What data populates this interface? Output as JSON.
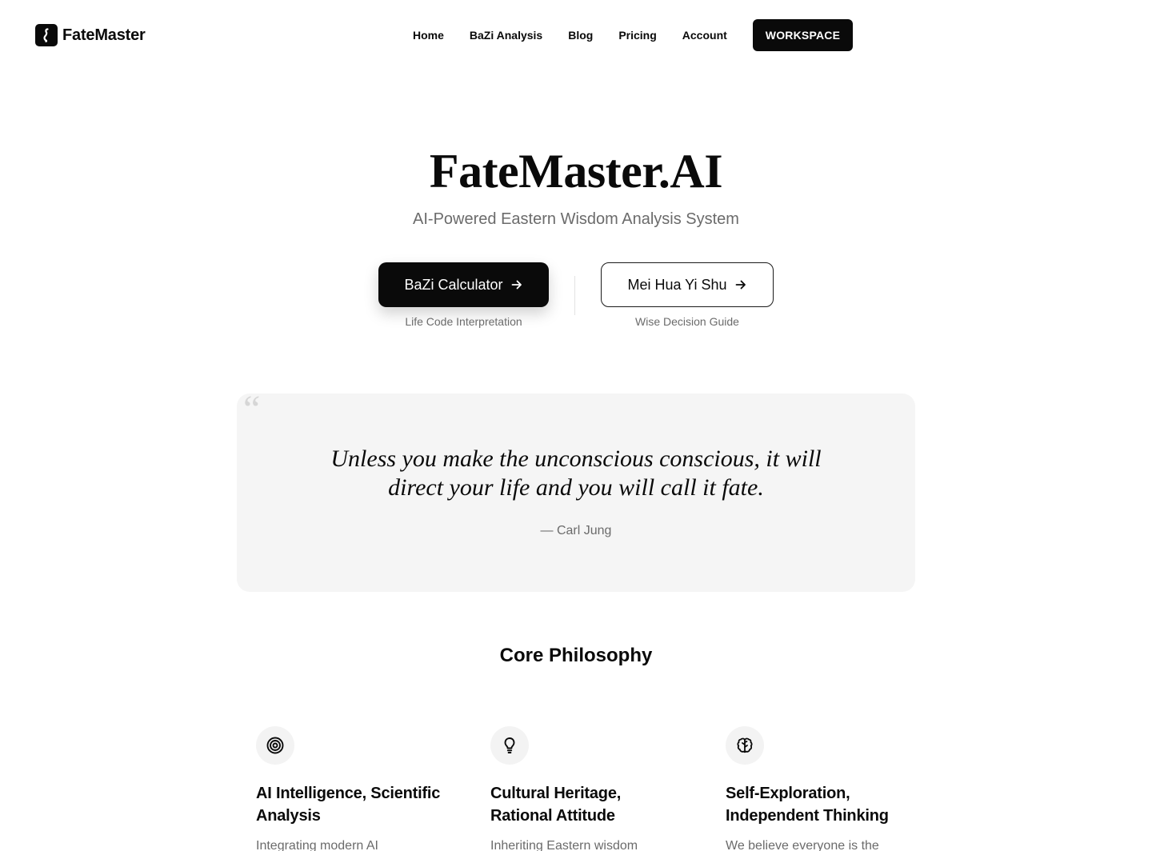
{
  "brand": {
    "name": "FateMaster"
  },
  "nav": {
    "links": [
      "Home",
      "BaZi Analysis",
      "Blog",
      "Pricing",
      "Account"
    ],
    "workspace_label": "WORKSPACE"
  },
  "hero": {
    "title": "FateMaster.AI",
    "subtitle": "AI-Powered Eastern Wisdom Analysis System",
    "primary": {
      "label": "BaZi Calculator",
      "caption": "Life Code Interpretation"
    },
    "secondary": {
      "label": "Mei Hua Yi Shu",
      "caption": "Wise Decision Guide"
    }
  },
  "quote": {
    "mark": "“",
    "text": "Unless you make the unconscious conscious, it will direct your life and you will call it fate.",
    "author": "— Carl Jung"
  },
  "philosophy": {
    "title": "Core Philosophy",
    "items": [
      {
        "icon": "target-icon",
        "title": "AI Intelligence, Scientific Analysis",
        "desc": "Integrating modern AI"
      },
      {
        "icon": "lightbulb-icon",
        "title": "Cultural Heritage, Rational Attitude",
        "desc": "Inheriting Eastern wisdom"
      },
      {
        "icon": "brain-icon",
        "title": "Self-Exploration, Independent Thinking",
        "desc": "We believe everyone is the"
      }
    ]
  },
  "colors": {
    "primary": "#0a0a0a",
    "muted": "#6b6b6b",
    "card": "#f5f5f5"
  }
}
